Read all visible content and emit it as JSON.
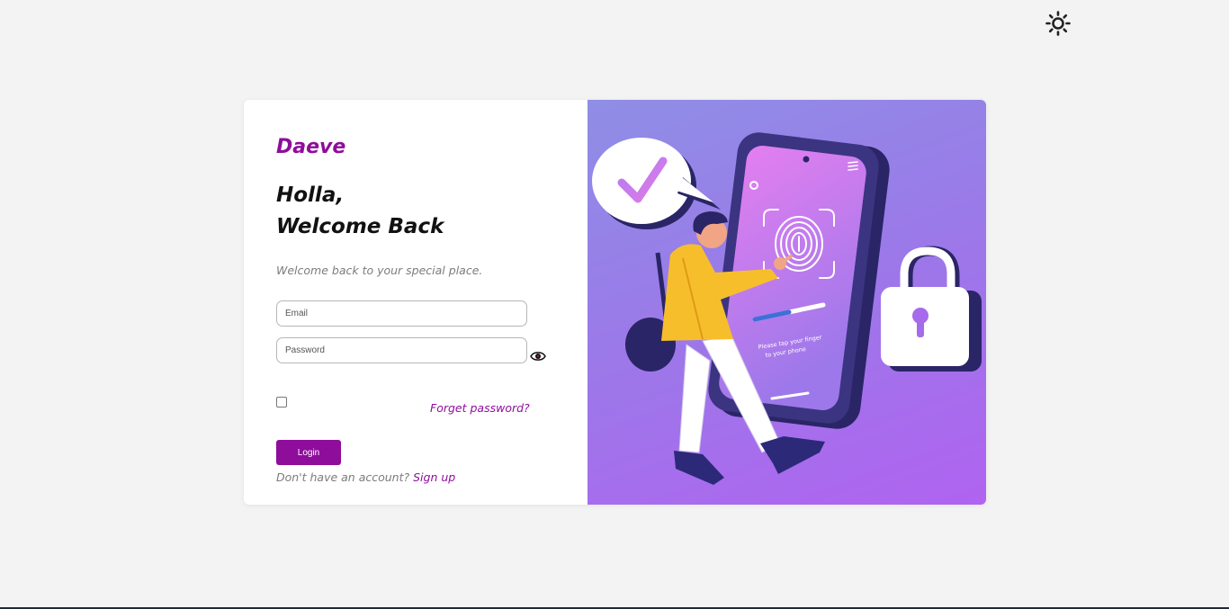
{
  "theme_toggle": {
    "icon": "sun-icon"
  },
  "login": {
    "brand": "Daeve",
    "heading_line1": "Holla,",
    "heading_line2": "Welcome Back",
    "subtitle": "Welcome back to your special place.",
    "email_placeholder": "Email",
    "password_placeholder": "Password",
    "show_password_icon": "eye-icon",
    "forgot_password": "Forget password?",
    "login_button": "Login",
    "signup_prompt": "Don't have an account?",
    "signup_link": "Sign up"
  },
  "illustration": {
    "phone_text_line1": "Please tap your finger",
    "phone_text_line2": "to your phone"
  },
  "colors": {
    "accent": "#8e0d9a",
    "page_background": "#f3f3f3",
    "illustration_gradient_start": "#8f8ee6",
    "illustration_gradient_end": "#b063f0"
  }
}
